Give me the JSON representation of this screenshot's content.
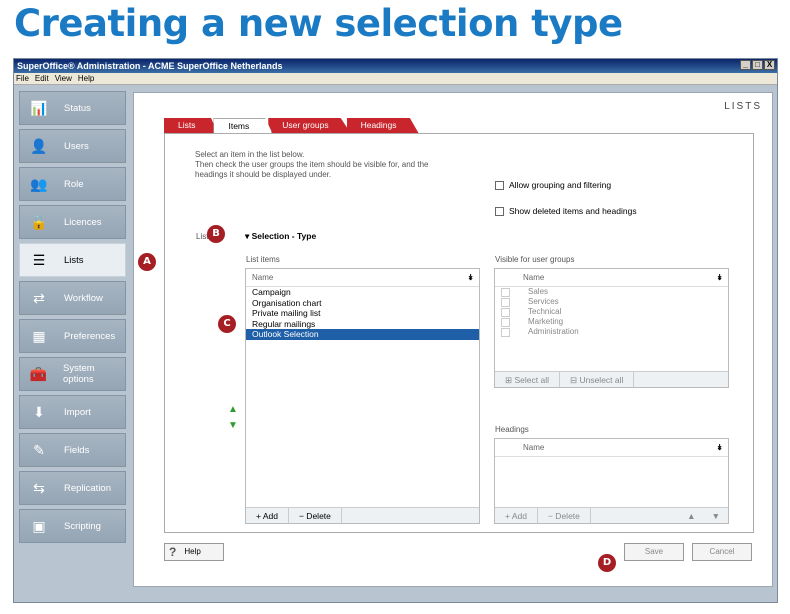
{
  "heading": "Creating a new selection type",
  "window": {
    "title": "SuperOffice® Administration - ACME SuperOffice Netherlands",
    "controls": [
      "_",
      "□",
      "X"
    ]
  },
  "menu": [
    "File",
    "Edit",
    "View",
    "Help"
  ],
  "sidebar": {
    "items": [
      {
        "label": "Status",
        "icon": "status-icon"
      },
      {
        "label": "Users",
        "icon": "users-icon"
      },
      {
        "label": "Role",
        "icon": "role-icon"
      },
      {
        "label": "Licences",
        "icon": "licences-icon"
      },
      {
        "label": "Lists",
        "icon": "lists-icon",
        "active": true
      },
      {
        "label": "Workflow",
        "icon": "workflow-icon"
      },
      {
        "label": "Preferences",
        "icon": "preferences-icon"
      },
      {
        "label": "System options",
        "icon": "system-options-icon"
      },
      {
        "label": "Import",
        "icon": "import-icon"
      },
      {
        "label": "Fields",
        "icon": "fields-icon"
      },
      {
        "label": "Replication",
        "icon": "replication-icon"
      },
      {
        "label": "Scripting",
        "icon": "scripting-icon"
      }
    ]
  },
  "main": {
    "section_title": "LISTS",
    "tabs": [
      {
        "label": "Lists"
      },
      {
        "label": "Items",
        "active": true
      },
      {
        "label": "User groups"
      },
      {
        "label": "Headings"
      }
    ],
    "instructions": [
      "Select an item in the list below.",
      "Then check the user groups the item should be visible for, and the",
      "headings it should be displayed under."
    ],
    "allow_grouping": "Allow grouping and filtering",
    "show_deleted": "Show deleted items and headings",
    "list_label": "List:",
    "list_value": "▾ Selection - Type",
    "list_items": {
      "title": "List items",
      "column": "Name",
      "rows": [
        "Campaign",
        "Organisation chart",
        "Private mailing list",
        "Regular mailings",
        "Outlook Selection"
      ],
      "selected_index": 4,
      "add": "+ Add",
      "delete": "− Delete"
    },
    "visible_groups": {
      "title": "Visible for user groups",
      "column": "Name",
      "rows": [
        "Sales",
        "Services",
        "Technical",
        "Marketing",
        "Administration"
      ],
      "select_all": "Select all",
      "unselect_all": "Unselect all"
    },
    "headings": {
      "title": "Headings",
      "column": "Name",
      "add": "+ Add",
      "delete": "− Delete"
    },
    "help": "Help",
    "save": "Save",
    "cancel": "Cancel"
  },
  "callouts": [
    "A",
    "B",
    "C",
    "D"
  ],
  "colors": {
    "accent": "#c8262c",
    "selection": "#1e5fa8",
    "heading": "#1a7ac4",
    "callout": "#a41e24"
  }
}
